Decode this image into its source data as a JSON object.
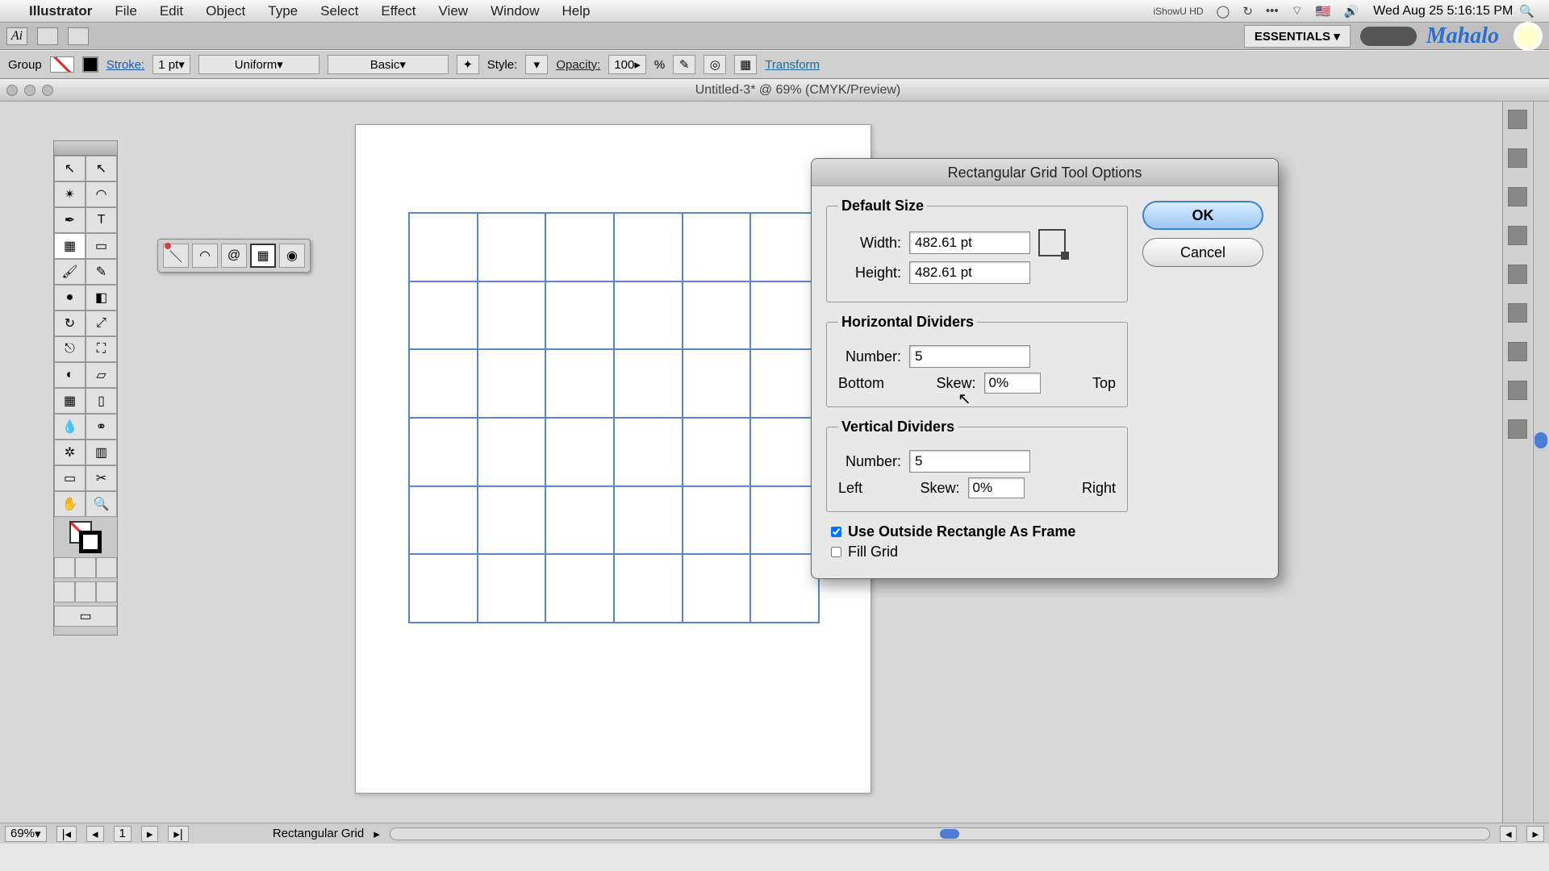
{
  "menubar": {
    "app": "Illustrator",
    "items": [
      "File",
      "Edit",
      "Object",
      "Type",
      "Select",
      "Effect",
      "View",
      "Window",
      "Help"
    ],
    "ishowu": "iShowU HD",
    "clock": "Wed Aug 25  5:16:15 PM"
  },
  "shelf": {
    "workspace": "ESSENTIALS ▾",
    "brand": "Mahalo"
  },
  "ctrl": {
    "group": "Group",
    "stroke": "Stroke:",
    "stroke_val": "1 pt",
    "uniform": "Uniform",
    "basic": "Basic",
    "style": "Style:",
    "opacity": "Opacity:",
    "opacity_val": "100",
    "pct": "%",
    "transform": "Transform"
  },
  "window": {
    "title": "Untitled-3* @ 69% (CMYK/Preview)"
  },
  "dialog": {
    "title": "Rectangular Grid Tool Options",
    "default_size": "Default Size",
    "width_lbl": "Width:",
    "width_val": "482.61 pt",
    "height_lbl": "Height:",
    "height_val": "482.61 pt",
    "hdiv": "Horizontal Dividers",
    "vdiv": "Vertical Dividers",
    "number_lbl": "Number:",
    "h_num": "5",
    "v_num": "5",
    "bottom": "Bottom",
    "top": "Top",
    "left": "Left",
    "right": "Right",
    "skew_lbl": "Skew:",
    "h_skew": "0%",
    "v_skew": "0%",
    "frame_chk": "Use Outside Rectangle As Frame",
    "fill_chk": "Fill Grid",
    "ok": "OK",
    "cancel": "Cancel"
  },
  "status": {
    "zoom": "69%",
    "page": "1",
    "tool": "Rectangular Grid"
  }
}
